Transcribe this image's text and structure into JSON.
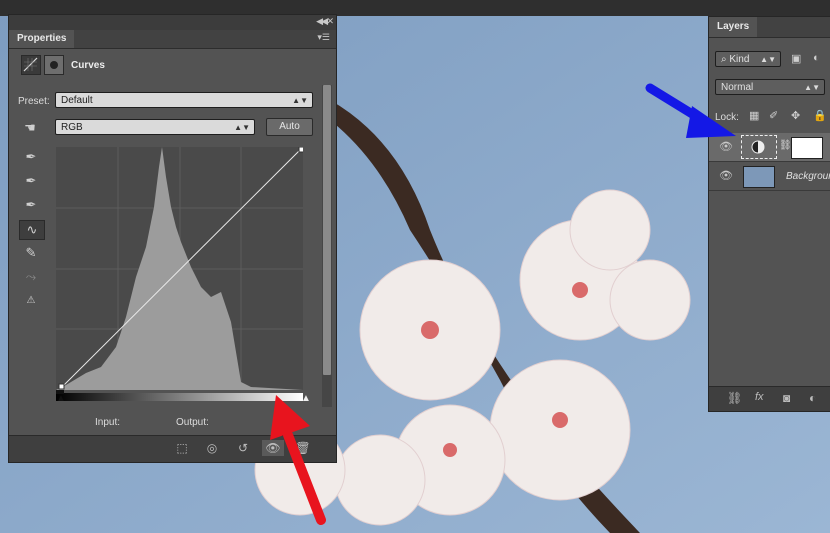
{
  "properties": {
    "tab_label": "Properties",
    "adjustment_title": "Curves",
    "preset_label": "Preset:",
    "preset_value": "Default",
    "channel_value": "RGB",
    "auto_label": "Auto",
    "input_label": "Input:",
    "output_label": "Output:"
  },
  "layers": {
    "tab_label": "Layers",
    "filter_kind": "Kind",
    "blend_mode": "Normal",
    "lock_label": "Lock:",
    "rows": [
      {
        "name": ""
      },
      {
        "name": "Background"
      }
    ],
    "fx_label": "fx"
  },
  "colors": {
    "panel_bg": "#535353",
    "blue_arrow": "#1418e6",
    "red_arrow": "#e8141e"
  },
  "icons": [
    "curves-adjustment-icon",
    "mask-icon",
    "hand-target-icon",
    "eyedropper-black-icon",
    "eyedropper-gray-icon",
    "eyedropper-white-icon",
    "curve-point-tool-icon",
    "pencil-icon",
    "smooth-icon",
    "clipping-warning-icon",
    "eye-icon",
    "link-icon",
    "fx-icon",
    "add-mask-icon",
    "adjustment-layer-icon"
  ]
}
